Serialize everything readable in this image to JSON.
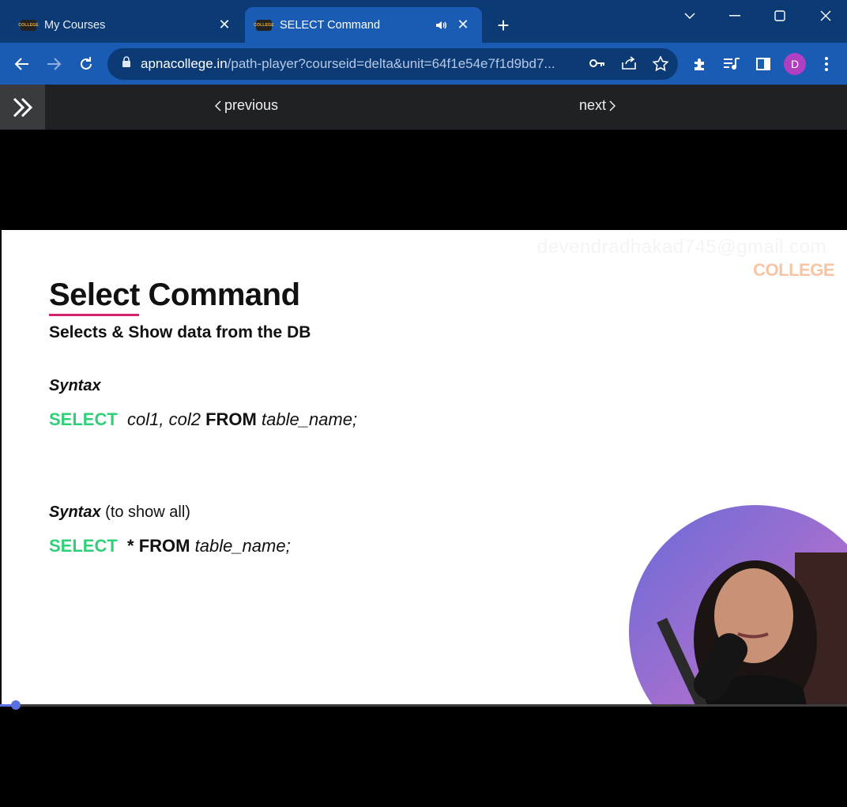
{
  "browser": {
    "tabs": [
      {
        "title": "My Courses",
        "favicon_text": "COLLEGE",
        "active": false
      },
      {
        "title": "SELECT Command",
        "favicon_text": "COLLEGE",
        "active": true,
        "audio": true
      }
    ],
    "address": {
      "domain": "apnacollege.in",
      "path": "/path-player?courseid=delta&unit=64f1e54e7f1d9bd7..."
    },
    "profile_initial": "D"
  },
  "player_nav": {
    "previous_label": "previous",
    "next_label": "next"
  },
  "slide": {
    "watermark_email": "devendradhakad745@gmail.com",
    "brand": "COLLEGE",
    "title": "Select Command",
    "subtitle": "Selects & Show data from the DB",
    "syntax_label": "Syntax",
    "code1": {
      "kw": "SELECT",
      "cols": "col1, col2",
      "from": "FROM",
      "table": "table_name;"
    },
    "syntax2_label": "Syntax",
    "syntax2_suffix": "(to show all)",
    "code2": {
      "kw": "SELECT",
      "star_from": "* FROM",
      "table": "table_name;"
    }
  },
  "playback": {
    "progress_fraction": 0.02
  },
  "colors": {
    "tabstrip": "#0c3a74",
    "toolbar": "#1a5bb4",
    "keyword": "#2fd178",
    "underline": "#d6226a",
    "brand": "#f7c5a3"
  }
}
